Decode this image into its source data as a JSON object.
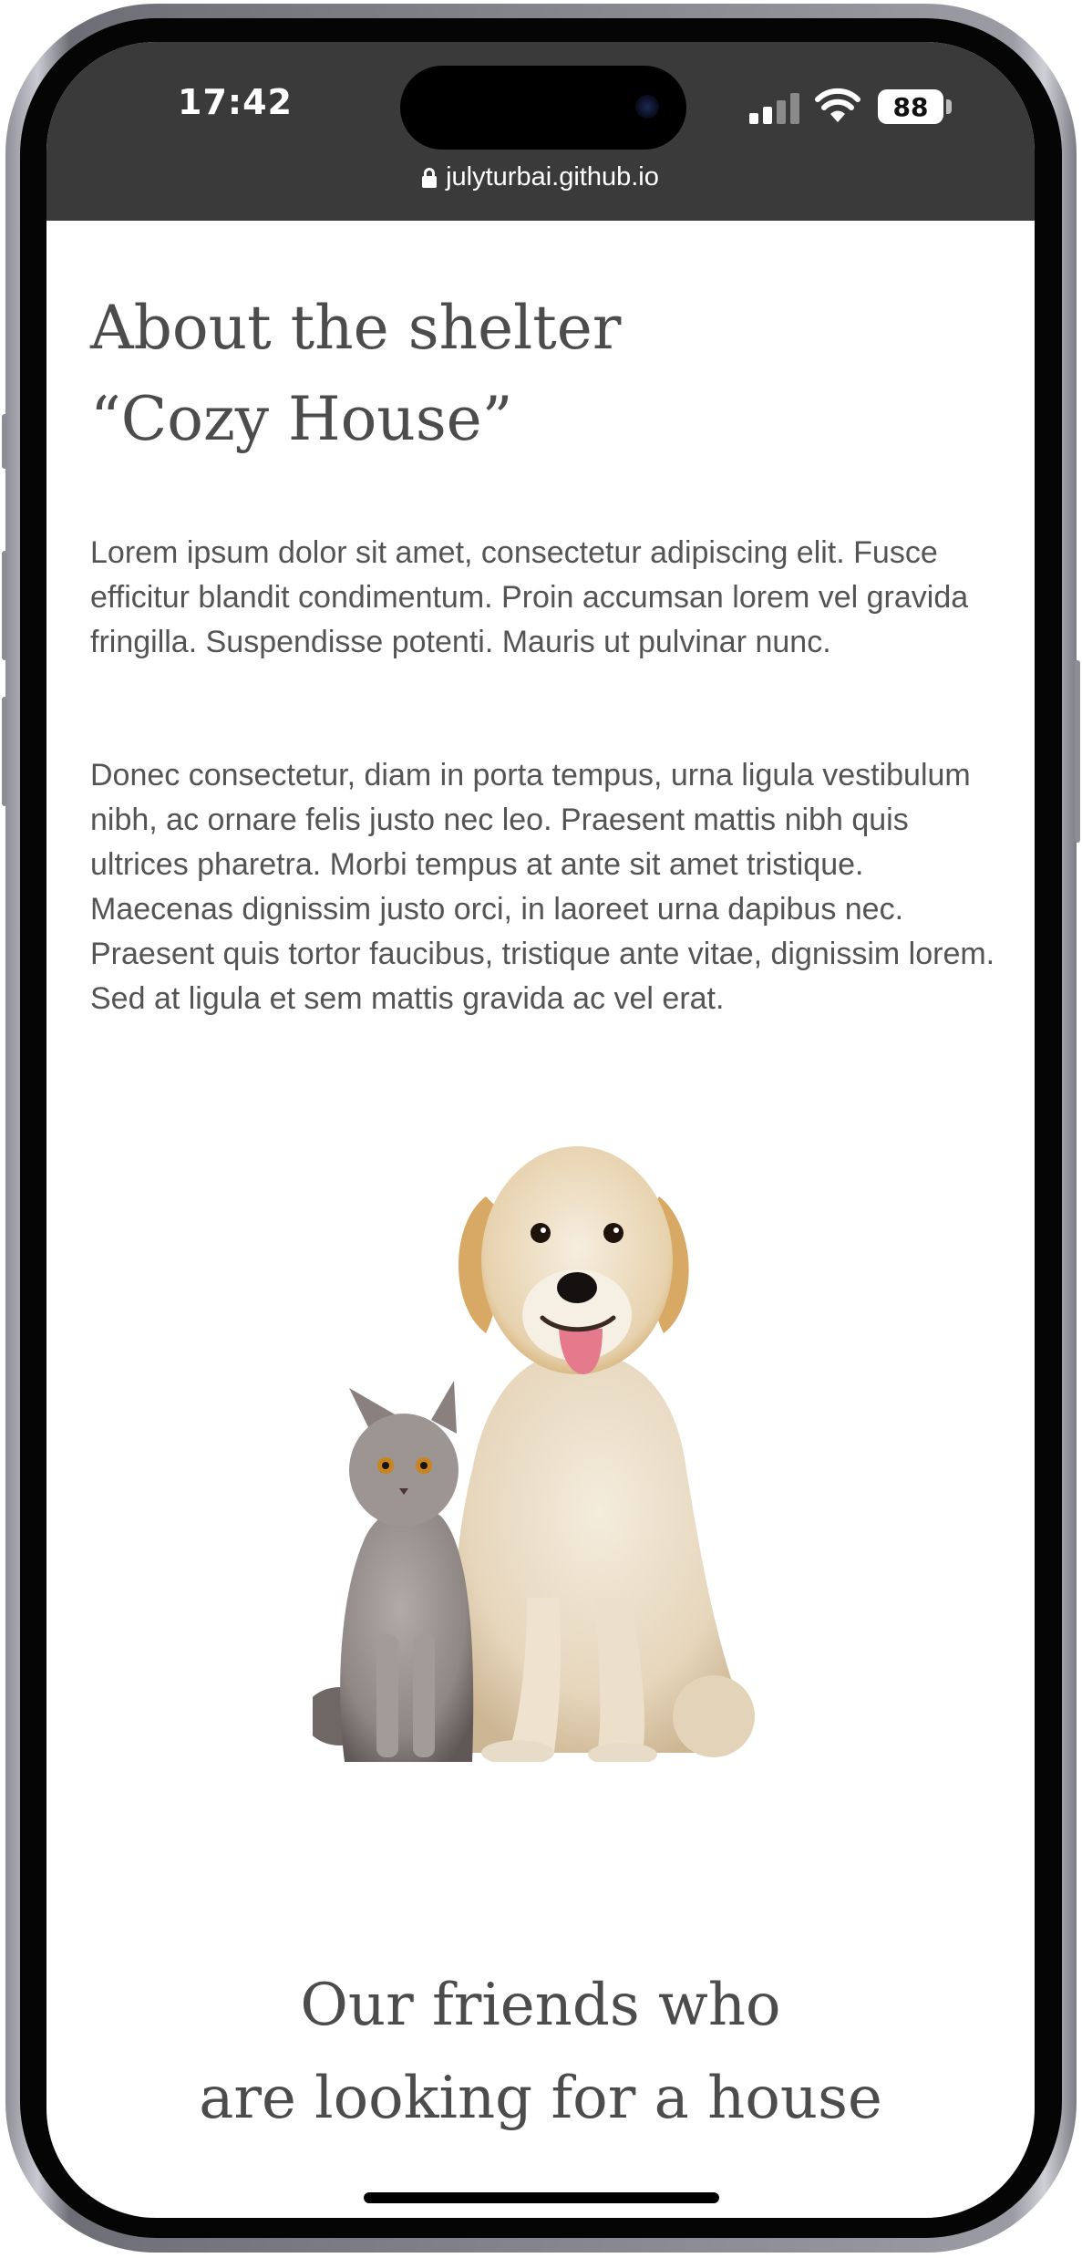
{
  "status_bar": {
    "time": "17:42",
    "battery": "88"
  },
  "browser": {
    "url": "julyturbai.github.io"
  },
  "about": {
    "title_line1": "About the shelter",
    "title_line2": "“Cozy House”",
    "paragraph1": "Lorem ipsum dolor sit amet, consectetur adipiscing elit. Fusce efficitur blandit condimentum. Proin accumsan lorem vel gravida fringilla. Suspendisse potenti. Mauris ut pulvinar nunc.",
    "paragraph2": "Donec consectetur, diam in porta tempus, urna ligula vestibulum nibh, ac ornare felis justo nec leo. Praesent mattis nibh quis ultrices pharetra. Morbi tempus at ante sit amet tristique. Maecenas dignissim justo orci, in laoreet urna dapibus nec. Praesent quis tortor faucibus, tristique ante vitae, dignissim lorem. Sed at ligula et sem mattis gravida ac vel erat."
  },
  "friends": {
    "title_line1": "Our friends who",
    "title_line2": "are looking for a house"
  },
  "colors": {
    "heading": "#4c4c4c",
    "body_text": "#545454",
    "top_bar": "#3a3a3a",
    "background": "#ffffff"
  }
}
